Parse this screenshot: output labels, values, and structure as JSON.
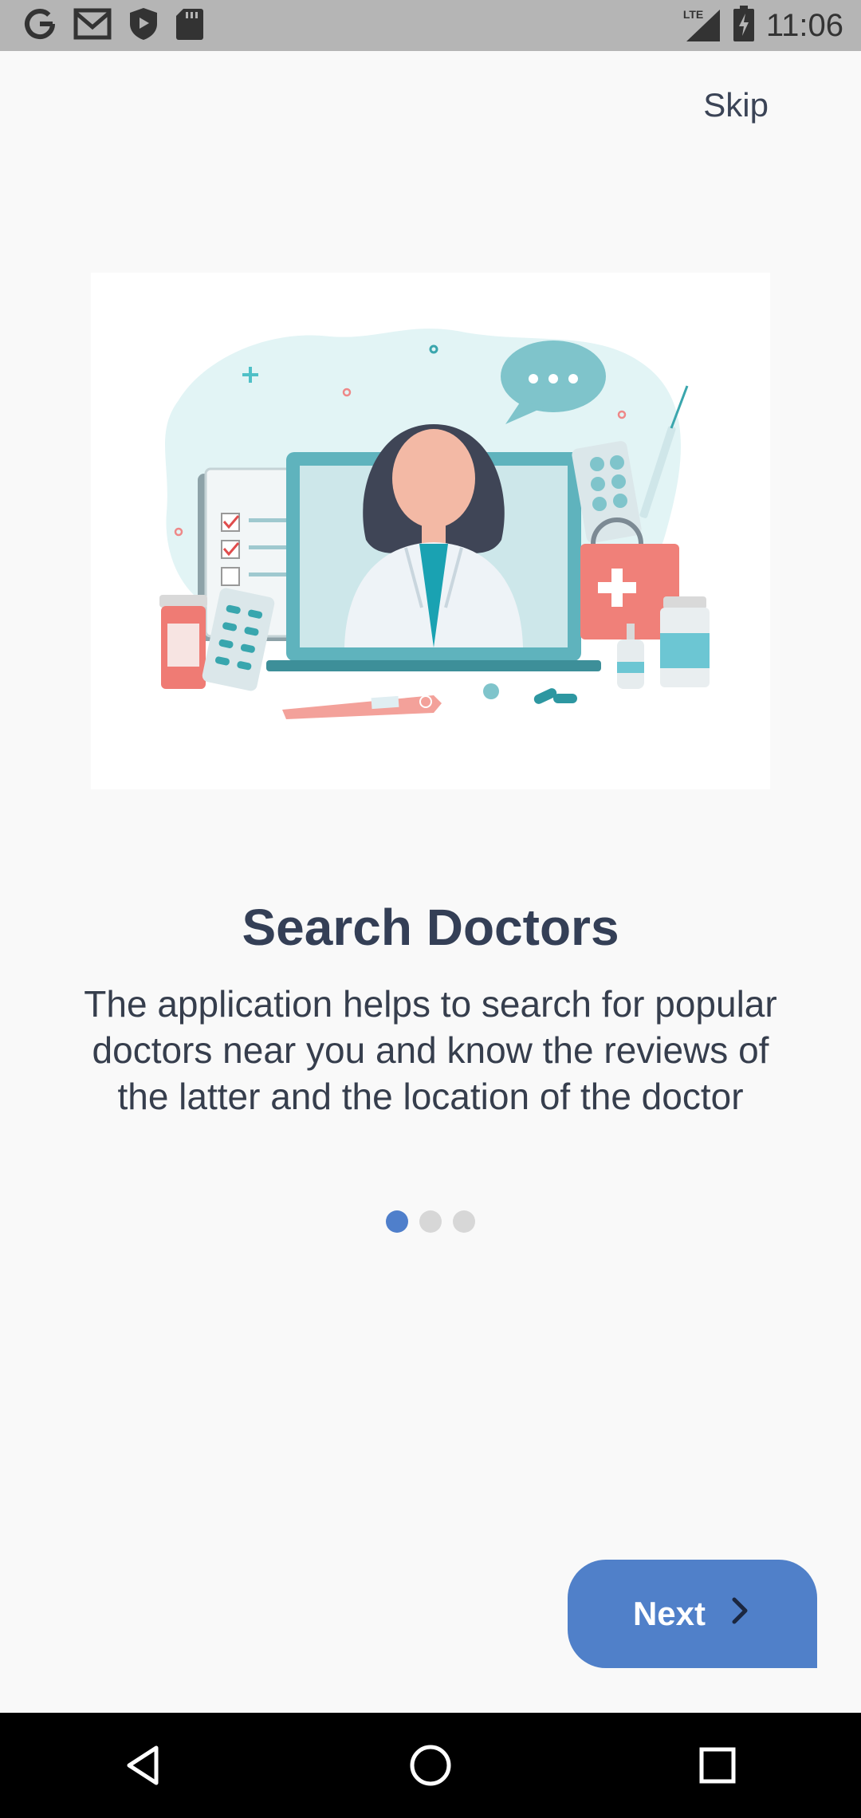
{
  "status_bar": {
    "time": "11:06",
    "network": "LTE",
    "icons": [
      "google-icon",
      "gmail-icon",
      "shield-icon",
      "sd-card-icon",
      "signal-icon",
      "battery-icon"
    ]
  },
  "onboarding": {
    "skip_label": "Skip",
    "title": "Search Doctors",
    "description": "The application helps to search for popular doctors near you and know the reviews of the latter and the location of the doctor",
    "page_index": 0,
    "page_count": 3,
    "next_label": "Next"
  },
  "colors": {
    "accent": "#5080c9",
    "title": "#343f56",
    "dot_inactive": "#d7d7d7",
    "status_bar": "#b5b5b5"
  },
  "nav_bar": {
    "icons": [
      "back-icon",
      "home-icon",
      "recents-icon"
    ]
  }
}
